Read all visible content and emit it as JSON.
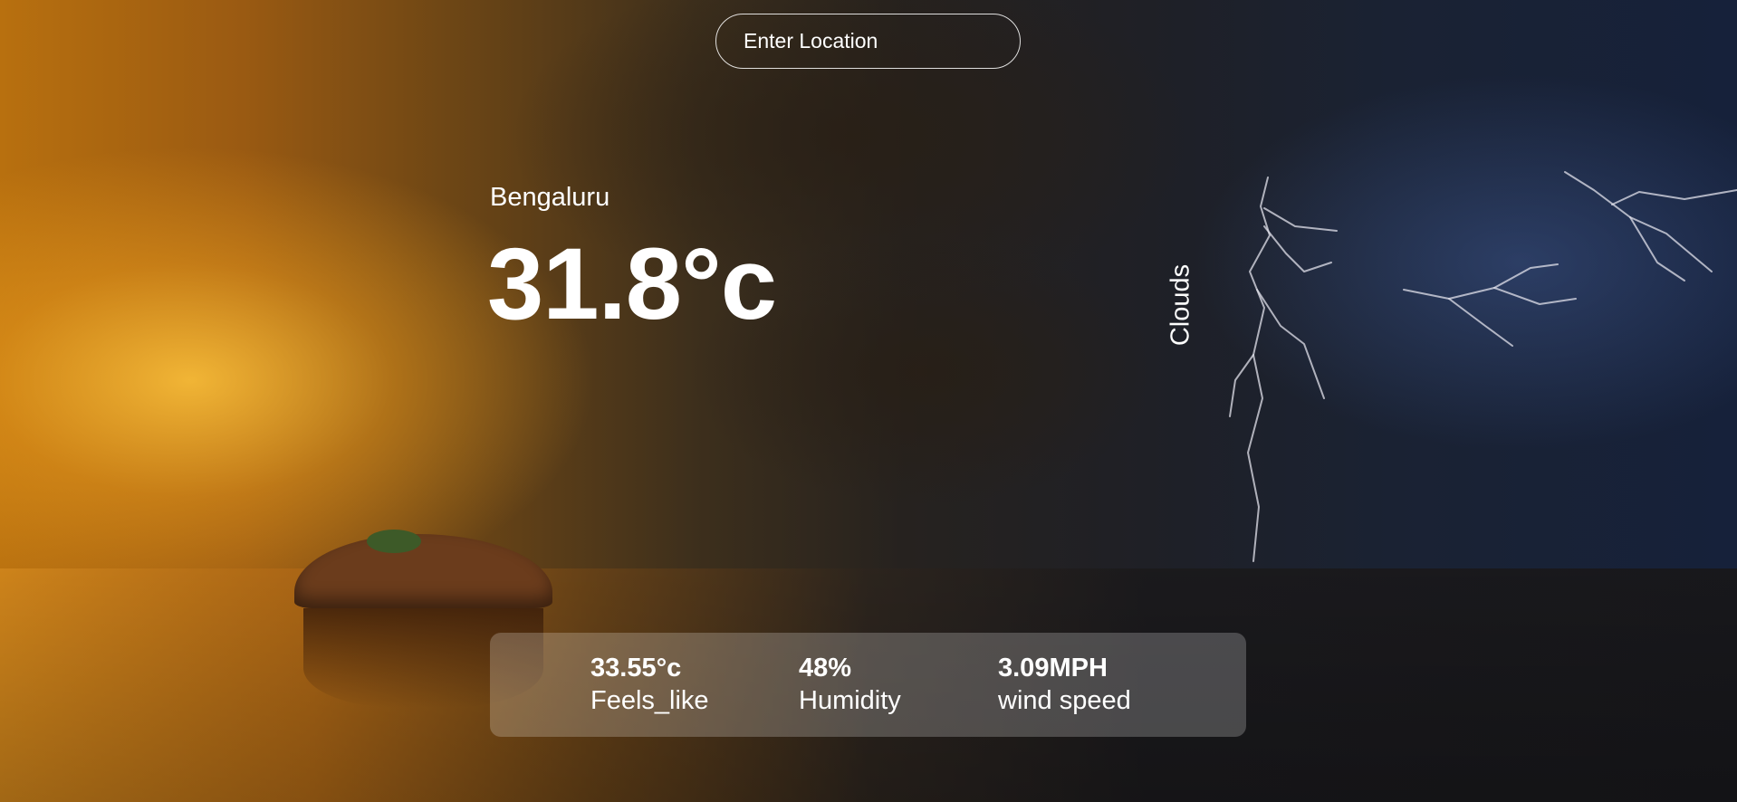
{
  "search": {
    "placeholder": "Enter Location",
    "value": ""
  },
  "weather": {
    "location": "Bengaluru",
    "temperature": "31.8°c",
    "condition": "Clouds"
  },
  "stats": {
    "feels_like": {
      "value": "33.55°c",
      "label": "Feels_like"
    },
    "humidity": {
      "value": "48%",
      "label": "Humidity"
    },
    "wind": {
      "value": "3.09MPH",
      "label": "wind speed"
    }
  }
}
